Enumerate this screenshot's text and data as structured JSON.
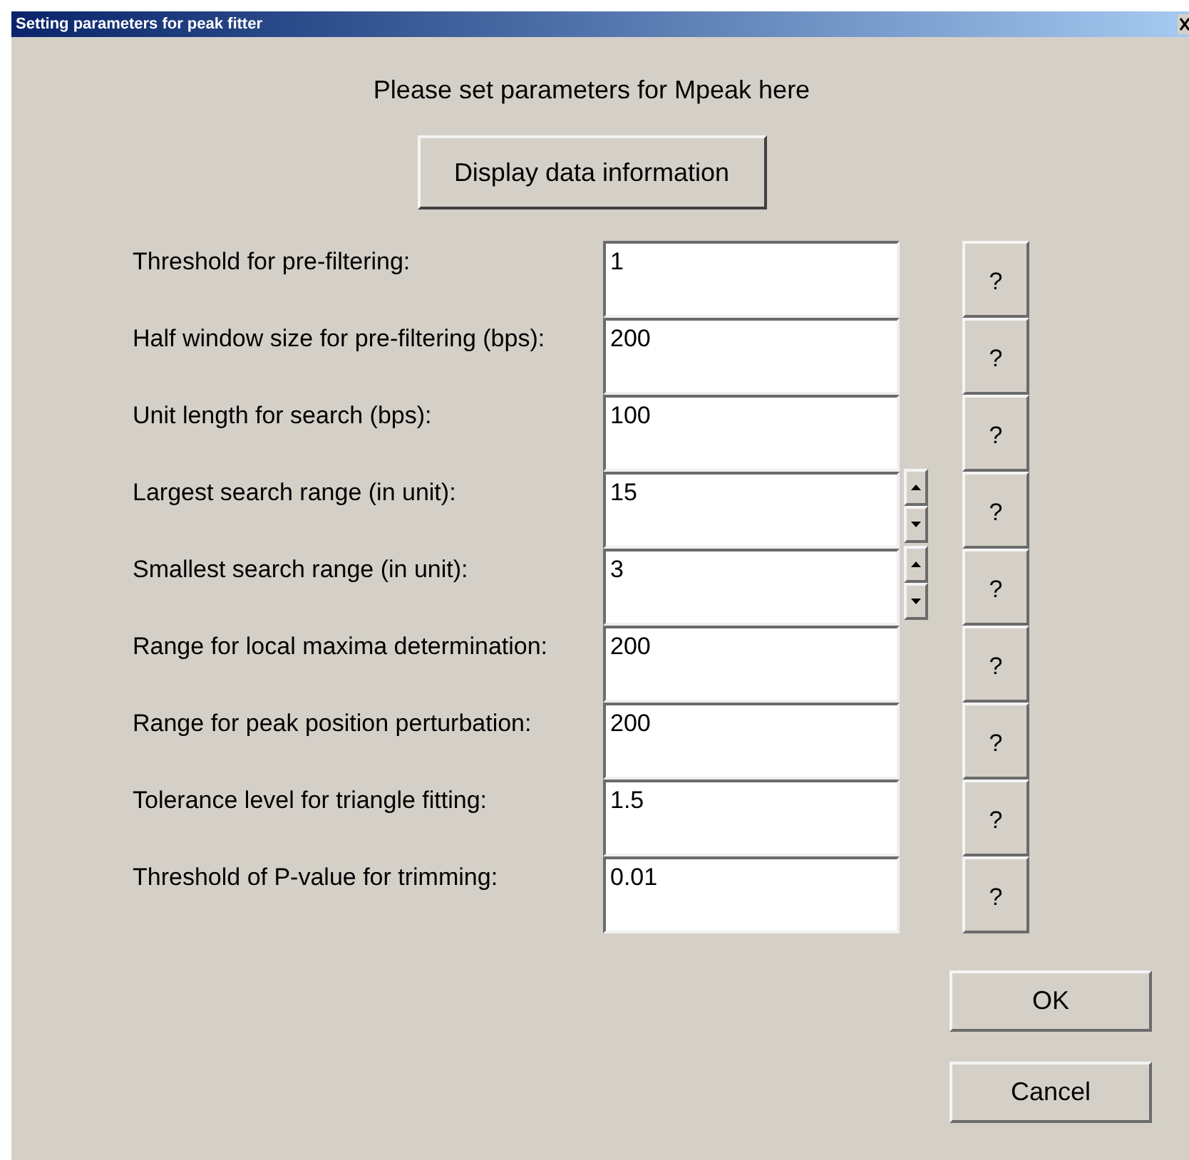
{
  "window": {
    "title": "Setting parameters for peak fitter"
  },
  "heading": "Please set parameters for Mpeak here",
  "info_button": "Display data information",
  "params": [
    {
      "kind": "text",
      "label": "Threshold for pre-filtering:",
      "value": "1",
      "help": "?"
    },
    {
      "kind": "text",
      "label": "Half window size for pre-filtering (bps):",
      "value": "200",
      "help": "?"
    },
    {
      "kind": "text",
      "label": "Unit length for search (bps):",
      "value": "100",
      "help": "?"
    },
    {
      "kind": "spinner",
      "label": "Largest search range (in unit):",
      "value": "15",
      "help": "?"
    },
    {
      "kind": "spinner",
      "label": "Smallest search range (in unit):",
      "value": "3",
      "help": "?"
    },
    {
      "kind": "text",
      "label": "Range for local maxima determination:",
      "value": "200",
      "help": "?"
    },
    {
      "kind": "text",
      "label": "Range for peak position perturbation:",
      "value": "200",
      "help": "?"
    },
    {
      "kind": "text",
      "label": "Tolerance level for triangle fitting:",
      "value": "1.5",
      "help": "?"
    },
    {
      "kind": "text",
      "label": "Threshold of P-value for trimming:",
      "value": "0.01",
      "help": "?"
    }
  ],
  "buttons": [
    "OK",
    "Cancel"
  ]
}
